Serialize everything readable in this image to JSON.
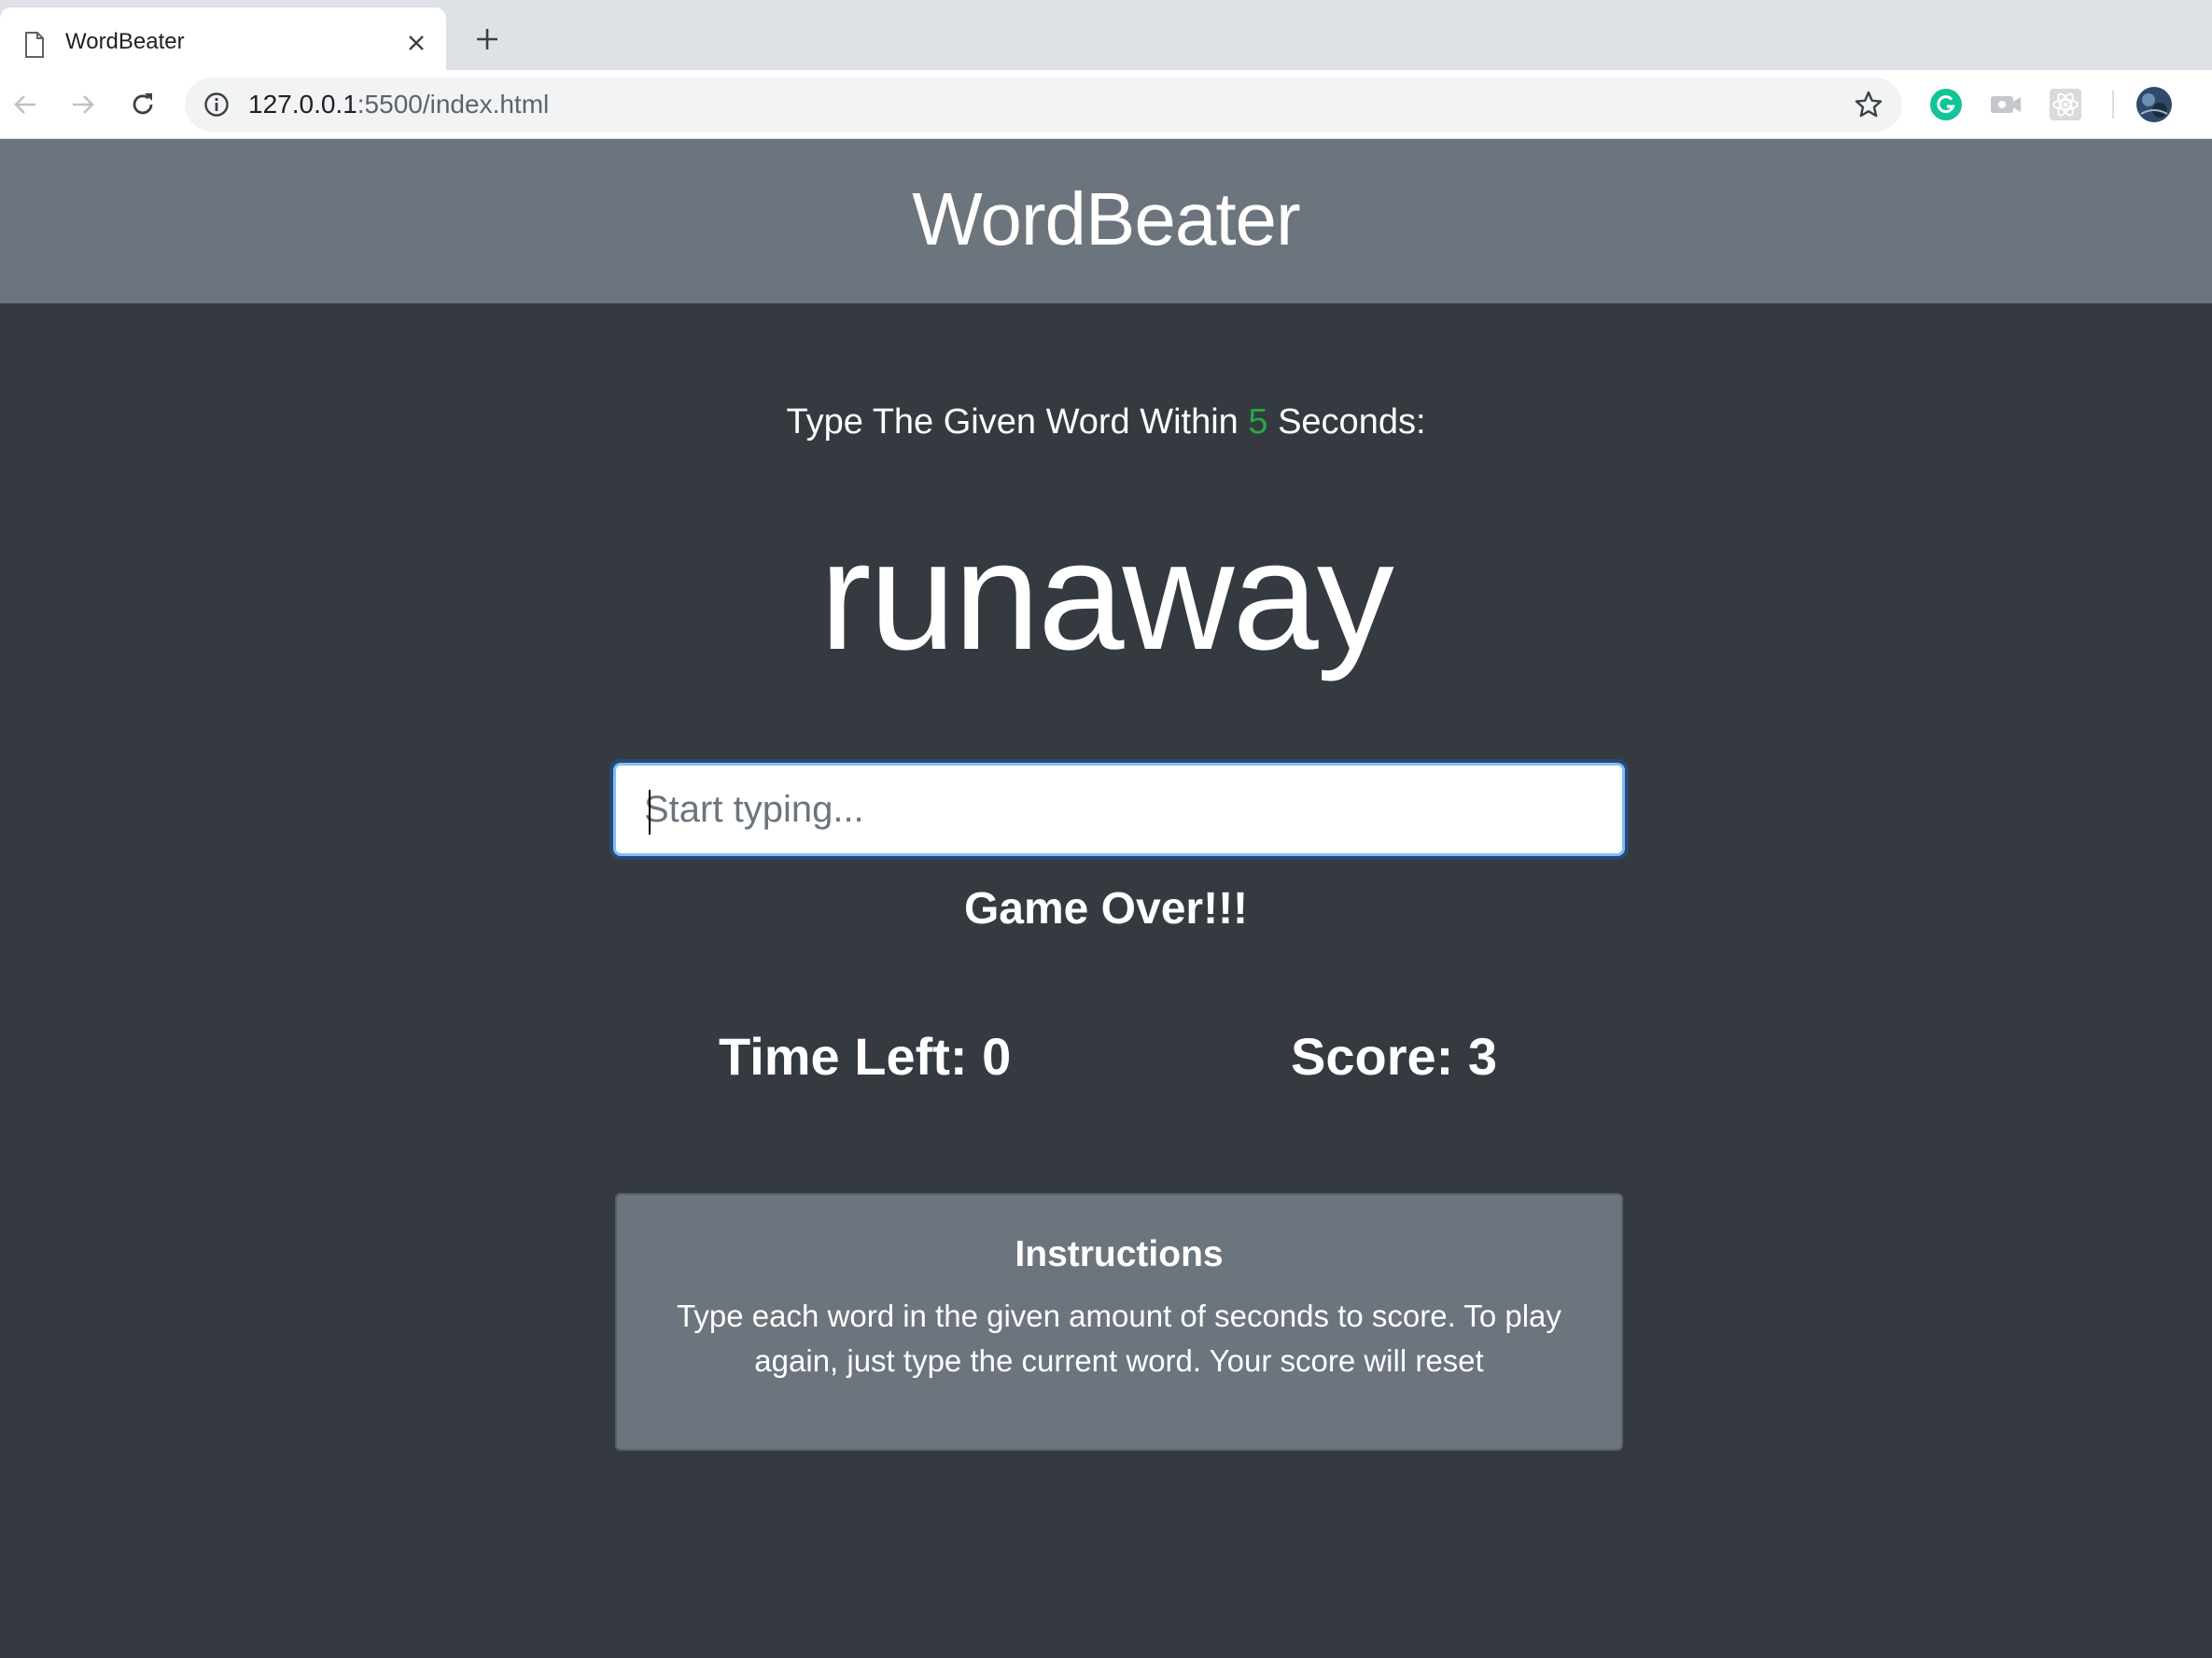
{
  "browser": {
    "tab_title": "WordBeater",
    "url_host": "127.0.0.1",
    "url_rest": ":5500/index.html",
    "icons": [
      "page-icon",
      "close-icon",
      "plus-icon",
      "back-arrow-icon",
      "forward-arrow-icon",
      "reload-icon",
      "info-icon",
      "star-icon",
      "grammarly-icon",
      "extension-icon",
      "react-devtools-icon",
      "profile-avatar"
    ]
  },
  "header": {
    "title": "WordBeater"
  },
  "game": {
    "lead_prefix": "Type The Given Word Within",
    "seconds": "5",
    "lead_suffix": "Seconds:",
    "current_word": "runaway",
    "input_placeholder": "Start typing...",
    "input_value": "",
    "message": "Game Over!!!",
    "time_left_label": "Time Left:",
    "time_left_value": "0",
    "score_label": "Score:",
    "score_value": "3"
  },
  "instructions": {
    "title": "Instructions",
    "body": "Type each word in the given amount of seconds to score. To play again, just type the current word. Your score will reset"
  },
  "colors": {
    "page_bg": "#343a40",
    "header_bg": "#6c757d",
    "seconds_accent": "#28a745",
    "input_focus": "#80bdff",
    "grammarly": "#15c39a"
  }
}
